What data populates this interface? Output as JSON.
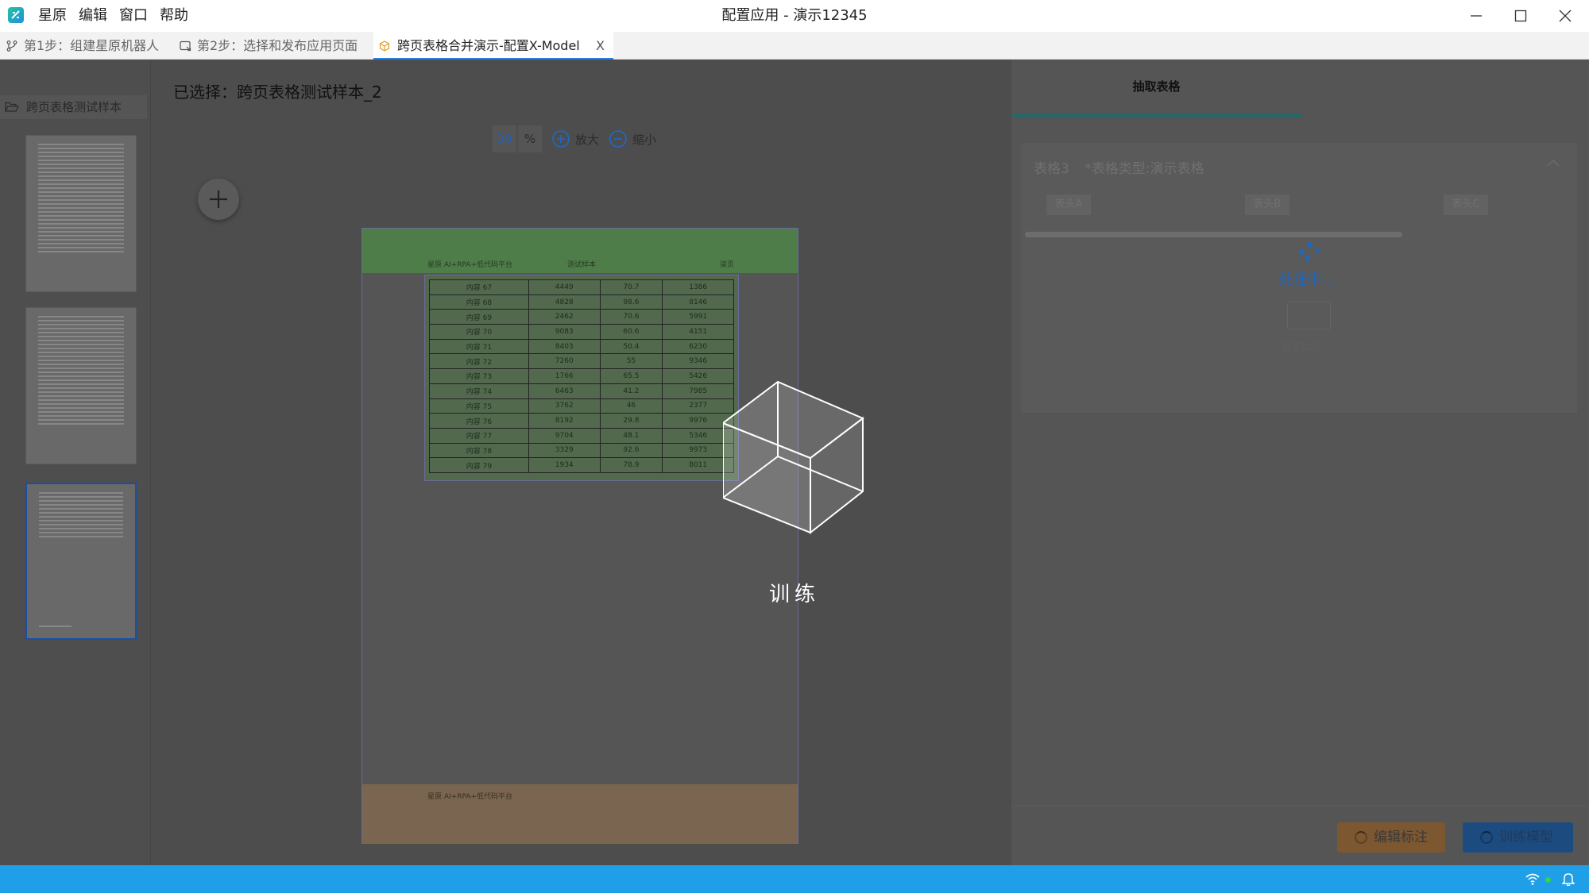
{
  "app": {
    "window_title": "配置应用 - 演示12345",
    "menu": [
      "星原",
      "编辑",
      "窗口",
      "帮助"
    ]
  },
  "tabs": [
    {
      "label": "第1步：组建星原机器人",
      "icon": "branch-icon"
    },
    {
      "label": "第2步：选择和发布应用页面",
      "icon": "publish-icon"
    },
    {
      "label": "跨页表格合并演示-配置X-Model",
      "icon": "cube-icon",
      "active": true,
      "close": "X"
    }
  ],
  "sidebar": {
    "folder_label": "跨页表格测试样本",
    "thumbnails": 3,
    "selected_index": 2
  },
  "viewer": {
    "selected_label": "已选择：跨页表格测试样本_2",
    "zoom_value": "30",
    "zoom_unit": "%",
    "zoom_in_label": "放大",
    "zoom_out_label": "缩小"
  },
  "document": {
    "header_left": "星原 AI+RPA+低代码平台",
    "header_center": "测试样本",
    "header_right": "柒页",
    "footer_left": "星原 AI+RPA+低代码平台",
    "table_rows": [
      [
        "内容 67",
        "4449",
        "70.7",
        "1386"
      ],
      [
        "内容 68",
        "4828",
        "98.6",
        "8146"
      ],
      [
        "内容 69",
        "2462",
        "70.6",
        "5991"
      ],
      [
        "内容 70",
        "9083",
        "60.6",
        "4151"
      ],
      [
        "内容 71",
        "8403",
        "50.4",
        "6230"
      ],
      [
        "内容 72",
        "7260",
        "55",
        "9346"
      ],
      [
        "内容 73",
        "1766",
        "65.5",
        "5426"
      ],
      [
        "内容 74",
        "6463",
        "41.2",
        "7985"
      ],
      [
        "内容 75",
        "3762",
        "46",
        "2377"
      ],
      [
        "内容 76",
        "8192",
        "29.8",
        "9976"
      ],
      [
        "内容 77",
        "9704",
        "48.1",
        "5346"
      ],
      [
        "内容 78",
        "3329",
        "92.6",
        "9973"
      ],
      [
        "内容 79",
        "1934",
        "78.9",
        "8011"
      ]
    ]
  },
  "right_panel": {
    "tab_label": "抽取表格",
    "card_title": "表格3",
    "card_subtitle": "*表格类型:演示表格",
    "columns": [
      "表头A",
      "表头B",
      "表头C"
    ],
    "processing_text": "处理中...",
    "empty_text": "暂无数据"
  },
  "actions": {
    "edit_label": "编辑标注",
    "train_label": "训练模型"
  },
  "overlay": {
    "text": "训练"
  },
  "colors": {
    "accent_blue": "#1e9fe8",
    "active_tab_underline": "#2e7de0",
    "edit_button": "#f0a040",
    "train_button": "#2a7de0"
  }
}
